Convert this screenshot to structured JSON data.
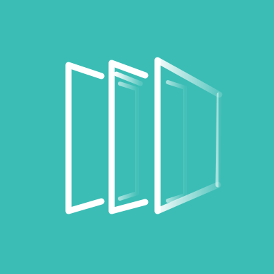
{
  "icon": {
    "name": "stacked-panels-logo",
    "background_color": "#3bbdb5",
    "stroke_color": "#ffffff",
    "panel_count": 3
  }
}
